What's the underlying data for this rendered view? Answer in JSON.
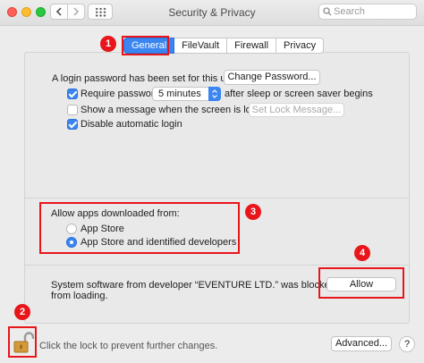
{
  "window": {
    "title": "Security & Privacy",
    "search_placeholder": "Search"
  },
  "tabs": [
    {
      "label": "General",
      "selected": true
    },
    {
      "label": "FileVault",
      "selected": false
    },
    {
      "label": "Firewall",
      "selected": false
    },
    {
      "label": "Privacy",
      "selected": false
    }
  ],
  "general": {
    "password_text": "A login password has been set for this user",
    "change_password_label": "Change Password...",
    "require_password": {
      "checked": true,
      "label": "Require password",
      "interval": "5 minutes",
      "suffix": "after sleep or screen saver begins"
    },
    "show_message": {
      "checked": false,
      "label": "Show a message when the screen is locked",
      "button": "Set Lock Message..."
    },
    "disable_auto_login": {
      "checked": true,
      "label": "Disable automatic login"
    }
  },
  "allow_apps": {
    "heading": "Allow apps downloaded from:",
    "options": [
      {
        "label": "App Store",
        "selected": false
      },
      {
        "label": "App Store and identified developers",
        "selected": true
      }
    ]
  },
  "blocked": {
    "line1": "System software from developer “EVENTURE LTD.” was blocked",
    "line2": "from loading.",
    "allow_label": "Allow"
  },
  "footer": {
    "lock_text": "Click the lock to prevent further changes.",
    "advanced_label": "Advanced...",
    "help_label": "?"
  },
  "annotations": {
    "color": "#e8161b",
    "badges": [
      "1",
      "2",
      "3",
      "4"
    ]
  },
  "colors": {
    "accent": "#3a85f0"
  }
}
